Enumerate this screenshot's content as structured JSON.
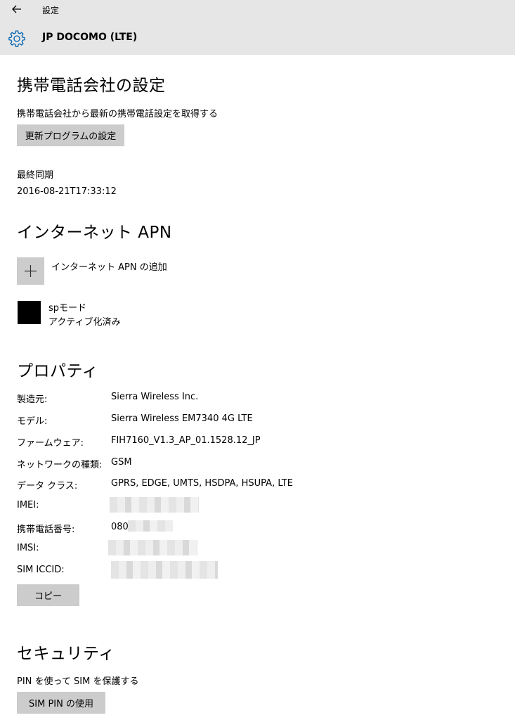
{
  "header": {
    "window_title": "設定",
    "device_name": "JP DOCOMO (LTE)"
  },
  "carrier": {
    "heading": "携帯電話会社の設定",
    "description": "携帯電話会社から最新の携帯電話設定を取得する",
    "update_button": "更新プログラムの設定",
    "last_sync_label": "最終同期",
    "last_sync_value": "2016-08-21T17:33:12"
  },
  "apn": {
    "heading": "インターネット APN",
    "add_label": "インターネット APN の追加",
    "item_name": "spモード",
    "item_status": "アクティブ化済み"
  },
  "properties": {
    "heading": "プロパティ",
    "rows": [
      {
        "label": "製造元:",
        "value": "Sierra Wireless Inc."
      },
      {
        "label": "モデル:",
        "value": "Sierra Wireless EM7340 4G LTE"
      },
      {
        "label": "ファームウェア:",
        "value": "FIH7160_V1.3_AP_01.1528.12_JP"
      },
      {
        "label": "ネットワークの種類:",
        "value": "GSM"
      },
      {
        "label": "データ クラス:",
        "value": "GPRS, EDGE, UMTS, HSDPA, HSUPA, LTE"
      },
      {
        "label": "IMEI:",
        "value": ""
      },
      {
        "label": "携帯電話番号:",
        "value": "080"
      },
      {
        "label": "IMSI:",
        "value": ""
      },
      {
        "label": "SIM ICCID:",
        "value": ""
      }
    ],
    "copy_button": "コピー"
  },
  "security": {
    "heading": "セキュリティ",
    "description": "PIN を使って SIM を保護する",
    "pin_button": "SIM PIN の使用"
  },
  "icons": {
    "back": "back-arrow-icon",
    "gear": "gear-icon",
    "add": "plus-icon"
  },
  "colors": {
    "header_bg": "#e6e6e6",
    "button_bg": "#cccccc",
    "accent": "#0063b1"
  }
}
